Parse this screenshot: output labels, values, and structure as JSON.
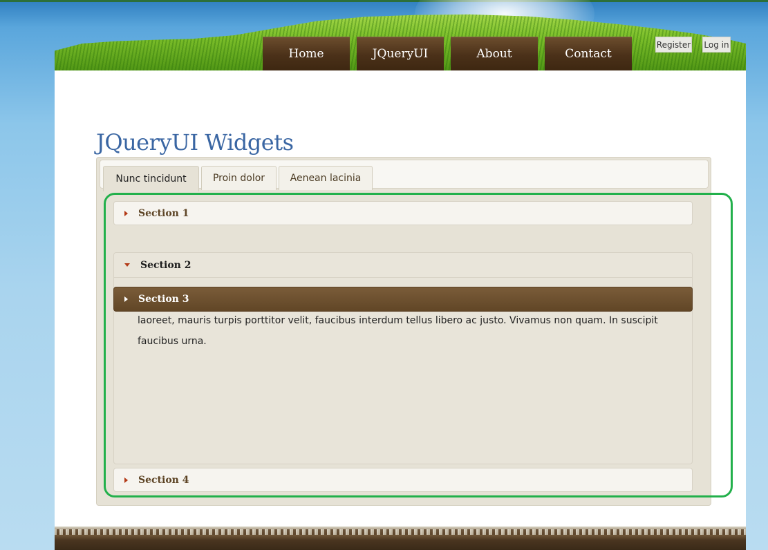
{
  "header": {
    "nav": [
      {
        "label": "Home"
      },
      {
        "label": "JQueryUI"
      },
      {
        "label": "About"
      },
      {
        "label": "Contact"
      }
    ],
    "register_label": "Register",
    "login_label": "Log in"
  },
  "main": {
    "title": "JQueryUI Widgets",
    "tabs": [
      {
        "label": "Nunc tincidunt",
        "active": true
      },
      {
        "label": "Proin dolor",
        "active": false
      },
      {
        "label": "Aenean lacinia",
        "active": false
      }
    ],
    "accordion": [
      {
        "label": "Section 1",
        "state": "collapsed"
      },
      {
        "label": "Section 2",
        "state": "expanded"
      },
      {
        "label": "Section 3",
        "state": "hover"
      },
      {
        "label": "Section 4",
        "state": "collapsed"
      }
    ],
    "panel_text": "laoreet, mauris turpis porttitor velit, faucibus interdum tellus libero ac justo. Vivamus non quam. In suscipit faucibus urna."
  },
  "colors": {
    "highlight_outline": "#22b04b",
    "nav_brown": "#4b3119",
    "title_blue": "#3a66a3",
    "arrow_red": "#b33a17"
  }
}
